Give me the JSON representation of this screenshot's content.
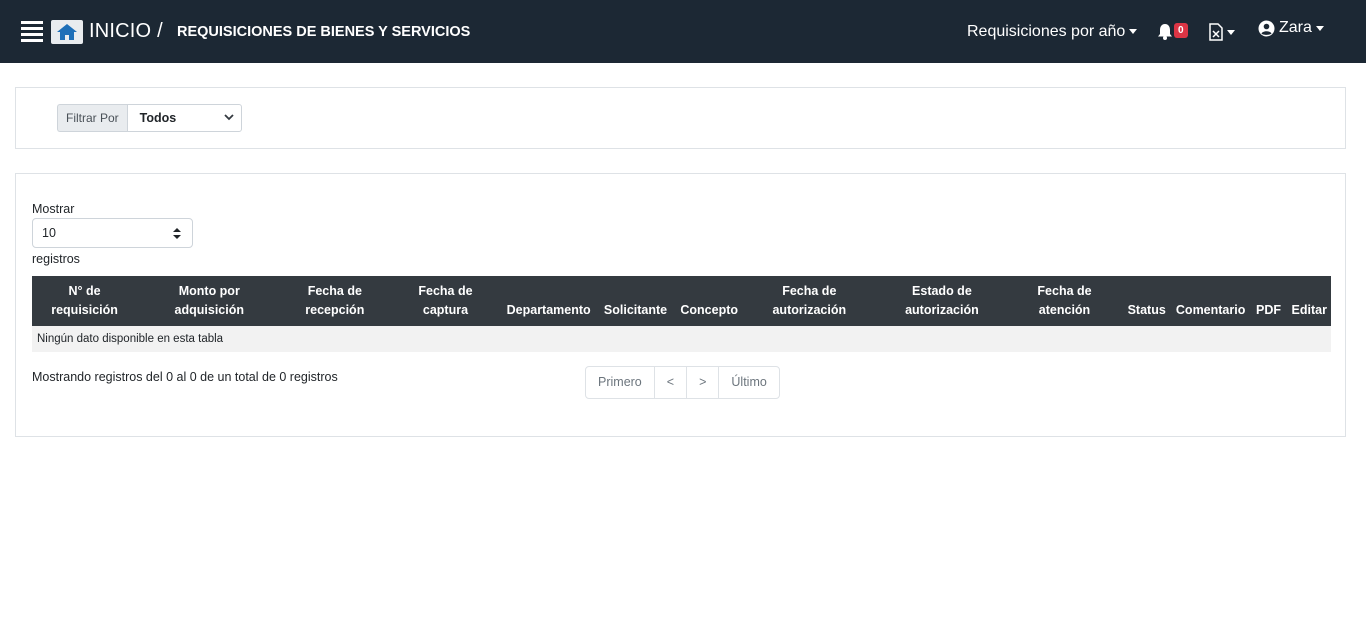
{
  "navbar": {
    "inicio_label": "INICIO /",
    "title": "REQUISICIONES DE BIENES Y SERVICIOS",
    "year_menu_label": "Requisiciones por año",
    "notifications_count": "0",
    "user_name": "Zara",
    "bg_color": "#1c2834",
    "icons": [
      "menu-icon",
      "home-icon",
      "bell-icon",
      "excel-file-icon",
      "user-circle-icon"
    ]
  },
  "filter": {
    "label": "Filtrar Por",
    "selected": "Todos"
  },
  "table_controls": {
    "show_label": "Mostrar",
    "page_length": "10",
    "records_label": "registros"
  },
  "table": {
    "columns": [
      [
        "N° de",
        "requisición"
      ],
      [
        "Monto por",
        "adquisición"
      ],
      [
        "Fecha de",
        "recepción"
      ],
      [
        "Fecha de",
        "captura"
      ],
      [
        "Departamento"
      ],
      [
        "Solicitante"
      ],
      [
        "Concepto"
      ],
      [
        "Fecha de",
        "autorización"
      ],
      [
        "Estado de",
        "autorización"
      ],
      [
        "Fecha de",
        "atención"
      ],
      [
        "Status"
      ],
      [
        "Comentario"
      ],
      [
        "PDF"
      ],
      [
        "Editar"
      ]
    ],
    "empty_message": "Ningún dato disponible en esta tabla",
    "header_color": "#343a40"
  },
  "footer": {
    "info": "Mostrando registros del 0 al 0 de un total de 0 registros",
    "pagination": [
      "Primero",
      "<",
      ">",
      "Último"
    ]
  }
}
